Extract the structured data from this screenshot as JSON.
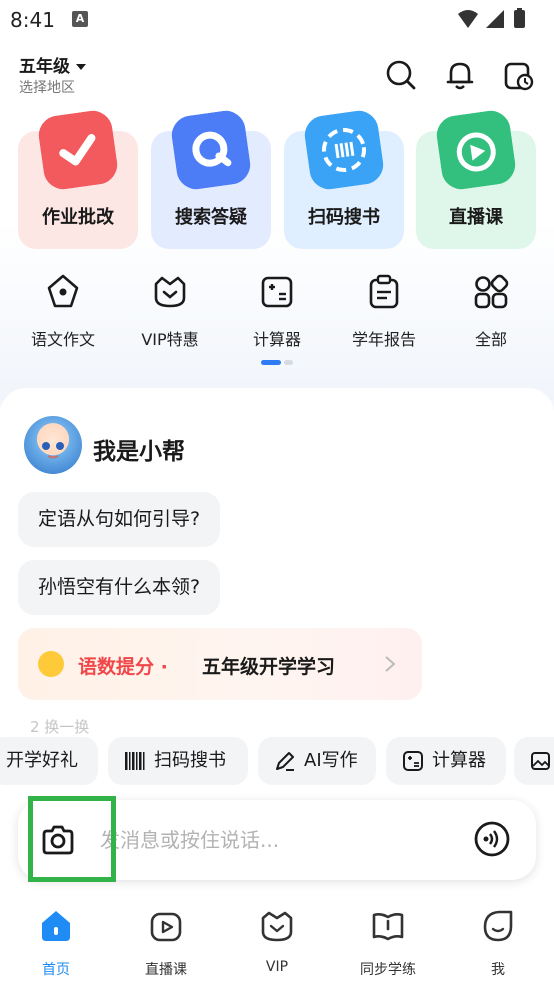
{
  "status_bar": {
    "time": "8:41",
    "notif_letter": "A"
  },
  "header": {
    "grade": "五年级",
    "region": "选择地区"
  },
  "main_tiles": [
    {
      "label": "作业批改",
      "bg": "#fde7e5",
      "art": "#f25a5e"
    },
    {
      "label": "搜索答疑",
      "bg": "#e3ebff",
      "art": "#4c7cf6"
    },
    {
      "label": "扫码搜书",
      "bg": "#e0efff",
      "art": "#3ba3f6"
    },
    {
      "label": "直播课",
      "bg": "#dff6ea",
      "art": "#33c07e"
    }
  ],
  "small_tools": [
    {
      "label": "语文作文",
      "icon": "pen-nib-icon"
    },
    {
      "label": "VIP特惠",
      "icon": "vip-crown-icon"
    },
    {
      "label": "计算器",
      "icon": "calculator-icon"
    },
    {
      "label": "学年报告",
      "icon": "report-clipboard-icon"
    },
    {
      "label": "全部",
      "icon": "grid-all-icon"
    }
  ],
  "assistant": {
    "name": "我是小帮",
    "suggestions": [
      "定语从句如何引导?",
      "孙悟空有什么本领?"
    ],
    "promo_highlight": "语数提分 ·",
    "promo_text": "五年级开学学习",
    "faded": "2 换一换"
  },
  "quick_chips": [
    {
      "label": "开学好礼",
      "icon": ""
    },
    {
      "label": "扫码搜书",
      "icon": "barcode-icon"
    },
    {
      "label": "AI写作",
      "icon": "pen-icon"
    },
    {
      "label": "计算器",
      "icon": "calculator-icon"
    },
    {
      "label": "",
      "icon": "image-add-icon"
    }
  ],
  "input": {
    "placeholder": "发消息或按住说话..."
  },
  "bottom_nav": [
    {
      "label": "首页",
      "icon": "home-icon",
      "active": true
    },
    {
      "label": "直播课",
      "icon": "live-play-icon",
      "active": false
    },
    {
      "label": "VIP",
      "icon": "vip-icon",
      "active": false
    },
    {
      "label": "同步学练",
      "icon": "book-icon",
      "active": false
    },
    {
      "label": "我",
      "icon": "profile-icon",
      "active": false
    }
  ],
  "colors": {
    "accent": "#1f8cf5",
    "highlight": "#32b34a",
    "promo_red": "#f0484a"
  }
}
